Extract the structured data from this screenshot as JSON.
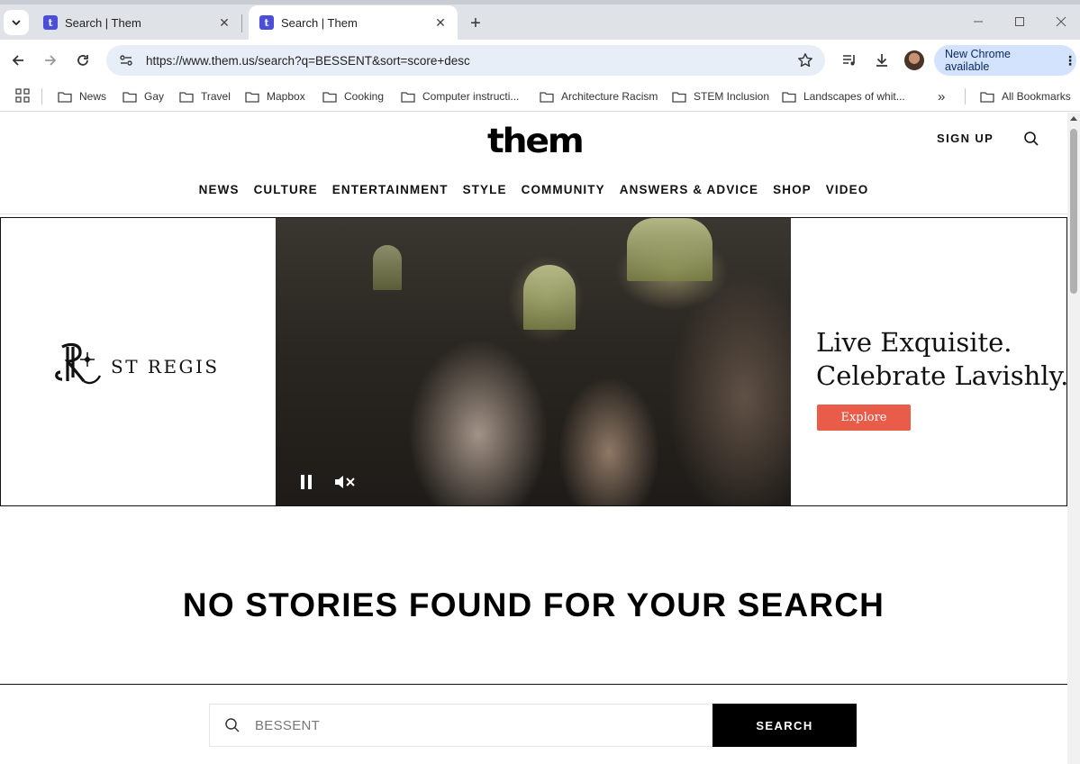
{
  "browser": {
    "tabs": [
      {
        "title": "Search | Them",
        "active": false
      },
      {
        "title": "Search | Them",
        "active": true
      }
    ],
    "url": "https://www.them.us/search?q=BESSENT&sort=score+desc",
    "update_label": "New Chrome available",
    "bookmarks": [
      "News",
      "Gay",
      "Travel",
      "Mapbox",
      "Cooking",
      "Computer instructi...",
      "Architecture Racism",
      "STEM Inclusion",
      "Landscapes of whit...",
      "All Bookmarks"
    ],
    "bookmark_overflow": "»"
  },
  "site": {
    "logo": "them",
    "sign_up": "SIGN UP",
    "nav": [
      "NEWS",
      "CULTURE",
      "ENTERTAINMENT",
      "STYLE",
      "COMMUNITY",
      "ANSWERS & ADVICE",
      "SHOP",
      "VIDEO"
    ]
  },
  "ad": {
    "brand": "ST REGIS",
    "headline_line1": "Live Exquisite.",
    "headline_line2": "Celebrate Lavishly.",
    "cta": "Explore"
  },
  "results": {
    "message": "NO STORIES FOUND FOR YOUR SEARCH"
  },
  "search": {
    "query": "BESSENT",
    "button": "SEARCH"
  },
  "colors": {
    "accent_cta": "#ea5c4a",
    "chrome_update_bg": "#d3e3fd",
    "omnibox_bg": "#e8eef7"
  }
}
